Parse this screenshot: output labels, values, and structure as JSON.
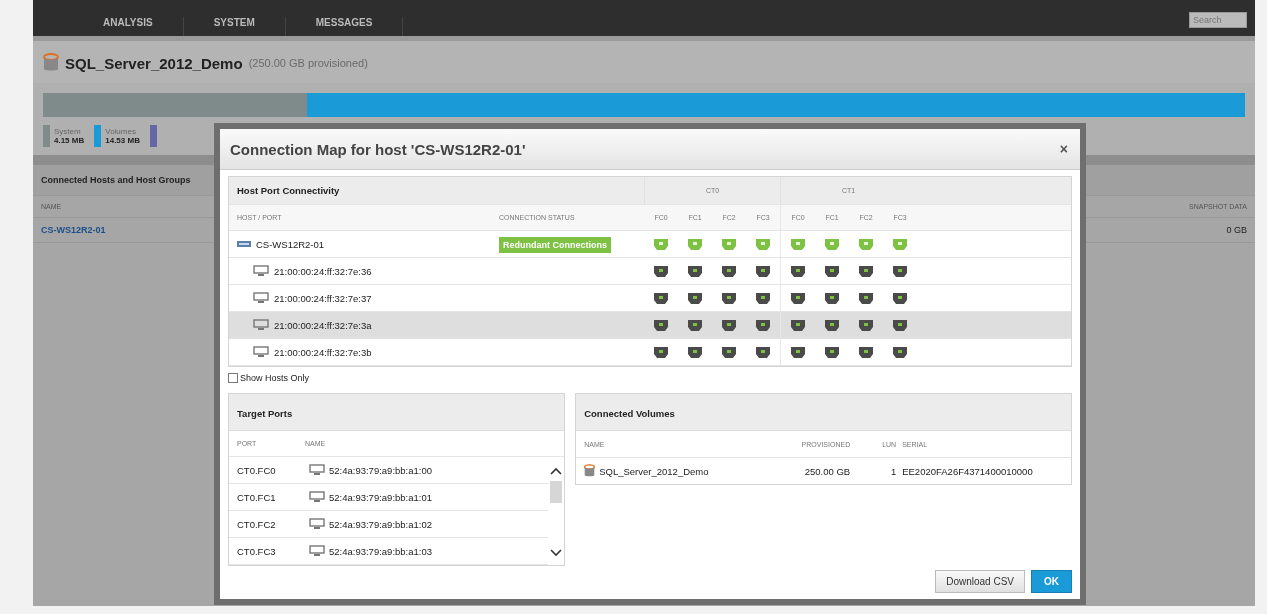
{
  "nav": {
    "tabs": [
      {
        "label": "ANALYSIS",
        "selected": false
      },
      {
        "label": "SYSTEM",
        "selected": false
      },
      {
        "label": "MESSAGES",
        "selected": false
      }
    ],
    "search": {
      "placeholder": "Search"
    }
  },
  "volume": {
    "name": "SQL_Server_2012_Demo",
    "provisioned": "(250.00 GB provisioned)"
  },
  "capacity": {
    "segments": [
      {
        "level": 0.22,
        "color": "#7f8a8a"
      },
      {
        "level": 0.78,
        "color": "#1a9ad6"
      }
    ],
    "legend": [
      {
        "label": "System",
        "value": "4.15 MB",
        "color": "#7f8a8a"
      },
      {
        "label": "Volumes",
        "value": "14.53 MB",
        "color": "#1a9ad6"
      }
    ]
  },
  "hosts_panel": {
    "title": "Connected Hosts and Host Groups",
    "columns": [
      "NAME",
      "SNAPSHOT DATA"
    ],
    "rows": [
      {
        "name": "CS-WS12R2-01",
        "snapshot_data": "0 GB"
      }
    ]
  },
  "dialog": {
    "title": "Connection Map for host 'CS-WS12R2-01'",
    "close": "×",
    "connectivity": {
      "title": "Host Port Connectivity",
      "controllers": [
        "CT0",
        "CT1"
      ],
      "columns": [
        "HOST / PORT",
        "CONNECTION STATUS"
      ],
      "ports": [
        "FC0",
        "FC1",
        "FC2",
        "FC3",
        "FC0",
        "FC1",
        "FC2",
        "FC3"
      ],
      "rows": [
        {
          "kind": "host",
          "name": "CS-WS12R2-01",
          "status": "Redundant Connections",
          "selected": false
        },
        {
          "kind": "port",
          "name": "21:00:00:24:ff:32:7e:36",
          "selected": false
        },
        {
          "kind": "port",
          "name": "21:00:00:24:ff:32:7e:37",
          "selected": false
        },
        {
          "kind": "port",
          "name": "21:00:00:24:ff:32:7e:3a",
          "selected": true
        },
        {
          "kind": "port",
          "name": "21:00:00:24:ff:32:7e:3b",
          "selected": false
        }
      ]
    },
    "show_hosts_only": {
      "label": "Show Hosts Only",
      "checked": false
    },
    "target_ports": {
      "title": "Target Ports",
      "columns": [
        "PORT",
        "NAME"
      ],
      "rows": [
        {
          "port": "CT0.FC0",
          "name": "52:4a:93:79:a9:bb:a1:00"
        },
        {
          "port": "CT0.FC1",
          "name": "52:4a:93:79:a9:bb:a1:01"
        },
        {
          "port": "CT0.FC2",
          "name": "52:4a:93:79:a9:bb:a1:02"
        },
        {
          "port": "CT0.FC3",
          "name": "52:4a:93:79:a9:bb:a1:03"
        }
      ]
    },
    "connected_volumes": {
      "title": "Connected Volumes",
      "columns": [
        "NAME",
        "PROVISIONED",
        "LUN",
        "SERIAL"
      ],
      "rows": [
        {
          "name": "SQL_Server_2012_Demo",
          "provisioned": "250.00 GB",
          "lun": "1",
          "serial": "EE2020FA26F4371400010000"
        }
      ]
    },
    "buttons": [
      {
        "label": "Download CSV",
        "kind": "secondary"
      },
      {
        "label": "OK",
        "kind": "primary"
      }
    ]
  }
}
